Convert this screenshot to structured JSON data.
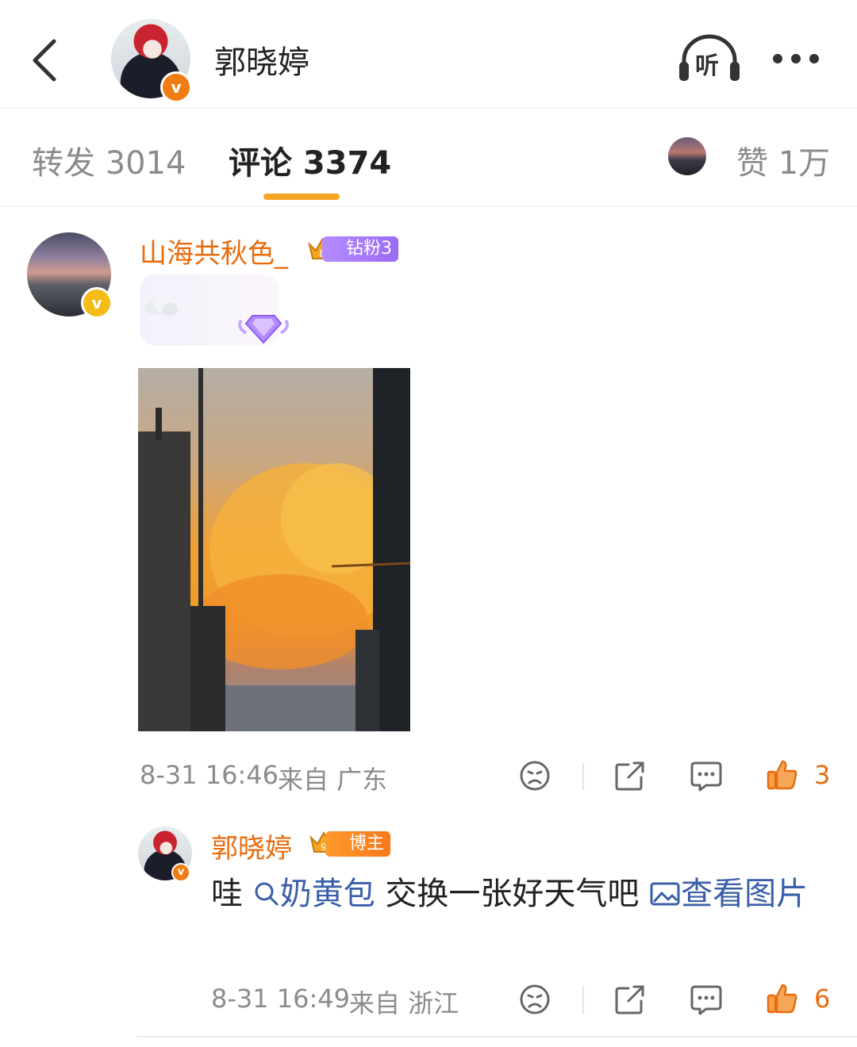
{
  "header": {
    "title": "郭晓婷",
    "listen_label": "听",
    "back_icon": "back-chevron-icon",
    "more_icon": "more-dots-icon"
  },
  "tabs": {
    "repost": "转发 3014",
    "comment": "评论 3374",
    "like": "赞 1万",
    "active": "comment",
    "accent_color": "#f6a623"
  },
  "comment": {
    "username": "山海共秋色_",
    "badge_label": "钻粉3",
    "badge_level": "8",
    "emoji": "cloud-icon",
    "sticker": "diamond-gem-icon",
    "time": "8-31 16:46",
    "source": "来自 广东",
    "like_count": "3"
  },
  "reply": {
    "username": "郭晓婷",
    "badge_label": "博主",
    "badge_level": "9",
    "text_prefix": "哇 ",
    "search_link": "奶黄包",
    "text_middle": " 交换一张好天气吧 ",
    "image_link": "查看图片",
    "time": "8-31 16:49",
    "source": "来自 浙江",
    "like_count": "6"
  },
  "colors": {
    "username": "#e86b0c",
    "link": "#3a5fa8",
    "meta": "#8b8b8b"
  }
}
